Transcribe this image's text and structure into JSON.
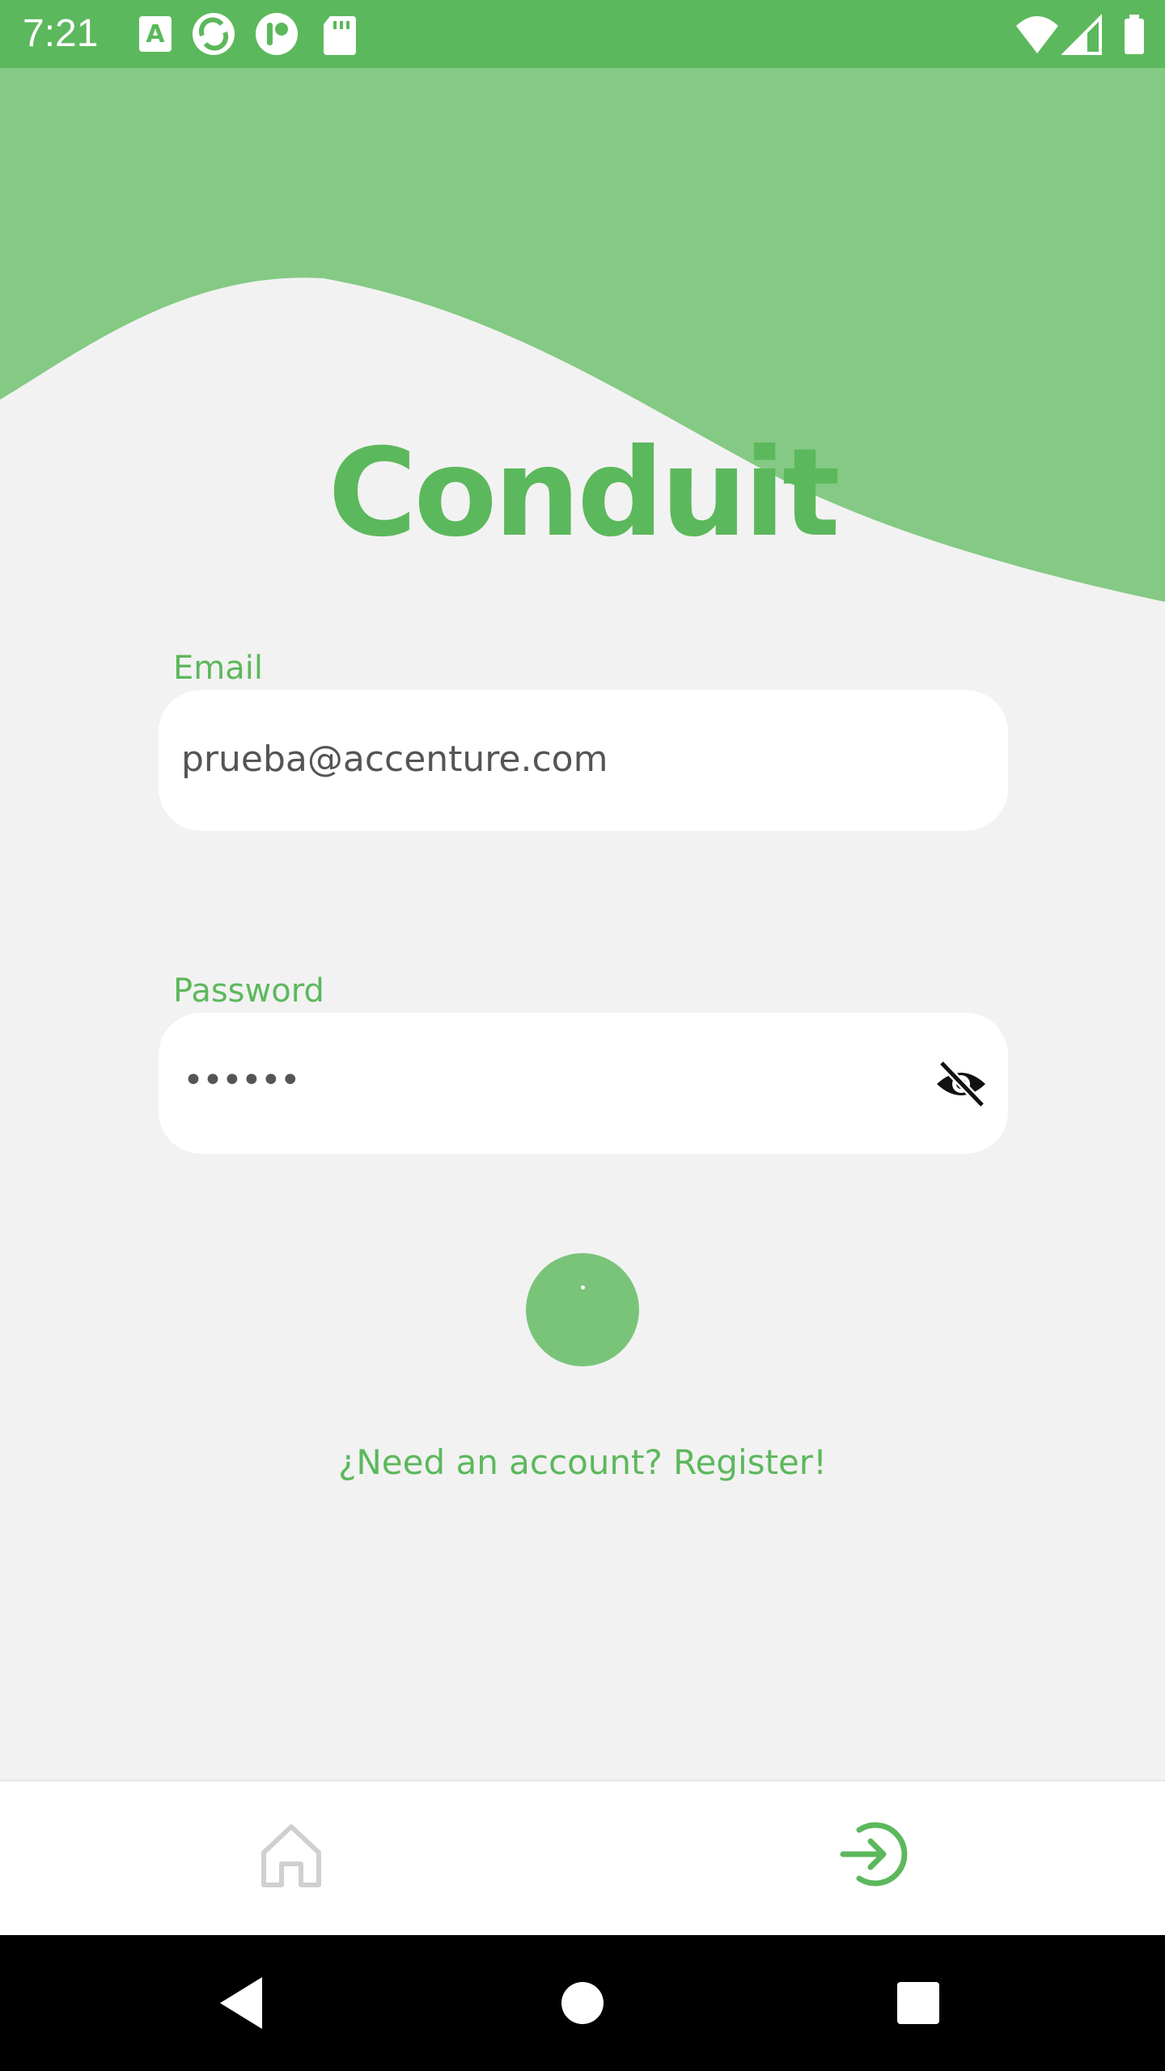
{
  "status_bar": {
    "time": "7:21",
    "icons_left": [
      "text-a-icon",
      "sync-icon",
      "app-icon",
      "sd-card-icon"
    ],
    "icons_right": [
      "wifi-icon",
      "signal-icon",
      "battery-icon"
    ]
  },
  "header": {
    "title": "Conduit"
  },
  "form": {
    "email_label": "Email",
    "email_value": "prueba@accenture.com",
    "password_label": "Password",
    "password_value": "••••••"
  },
  "register_link": "¿Need an account? Register!",
  "bottom_nav": {
    "items": [
      {
        "name": "home",
        "icon": "home-icon",
        "active": false
      },
      {
        "name": "login",
        "icon": "login-icon",
        "active": true
      }
    ]
  },
  "colors": {
    "primary": "#5cb85c",
    "wave": "#84c984",
    "background": "#f2f2f2",
    "button": "#7ac47a"
  }
}
